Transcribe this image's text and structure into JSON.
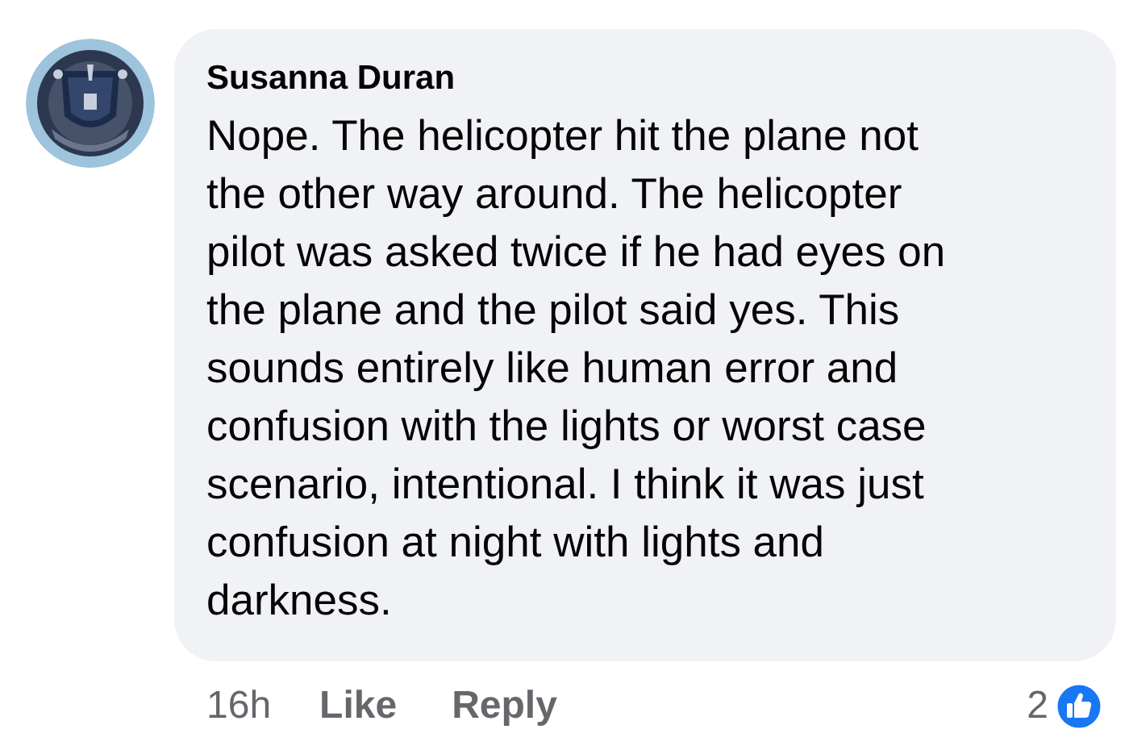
{
  "comment": {
    "author": "Susanna Duran",
    "lines": [
      "Nope. The helicopter hit the plane not",
      "the other way around. The helicopter",
      "pilot was asked twice if he had eyes on",
      "the plane and the pilot said yes. This",
      "sounds entirely like human error and",
      "confusion with the lights or worst case",
      "scenario, intentional. I think it was just",
      "confusion at night with lights and",
      "darkness."
    ],
    "time": "16h",
    "actions": [
      "Like",
      "Reply"
    ],
    "reaction_count": "2"
  }
}
